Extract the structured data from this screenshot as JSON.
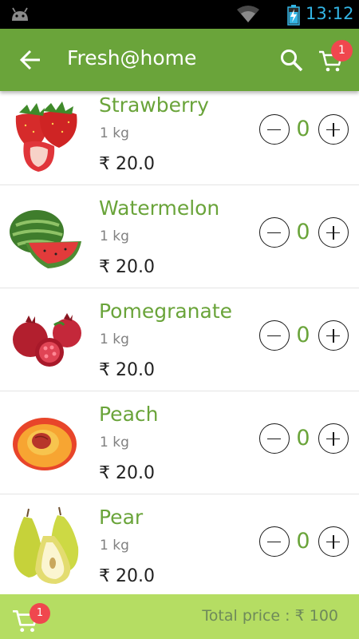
{
  "status_bar": {
    "time": "13:12"
  },
  "app_bar": {
    "title": "Fresh@home",
    "cart_count": "1"
  },
  "products": [
    {
      "name": "Strawberry",
      "quantity": "1 kg",
      "price": "₹ 20.0",
      "count": "0"
    },
    {
      "name": "Watermelon",
      "quantity": "1 kg",
      "price": "₹ 20.0",
      "count": "0"
    },
    {
      "name": "Pomegranate",
      "quantity": "1 kg",
      "price": "₹ 20.0",
      "count": "0"
    },
    {
      "name": "Peach",
      "quantity": "1 kg",
      "price": "₹ 20.0",
      "count": "0"
    },
    {
      "name": "Pear",
      "quantity": "1 kg",
      "price": "₹ 20.0",
      "count": "0"
    }
  ],
  "footer": {
    "cart_count": "1",
    "total_label": "Total price : ₹ 100"
  },
  "colors": {
    "accent": "#6aa43a",
    "footer": "#b5dd63",
    "badge": "#f0474e"
  }
}
